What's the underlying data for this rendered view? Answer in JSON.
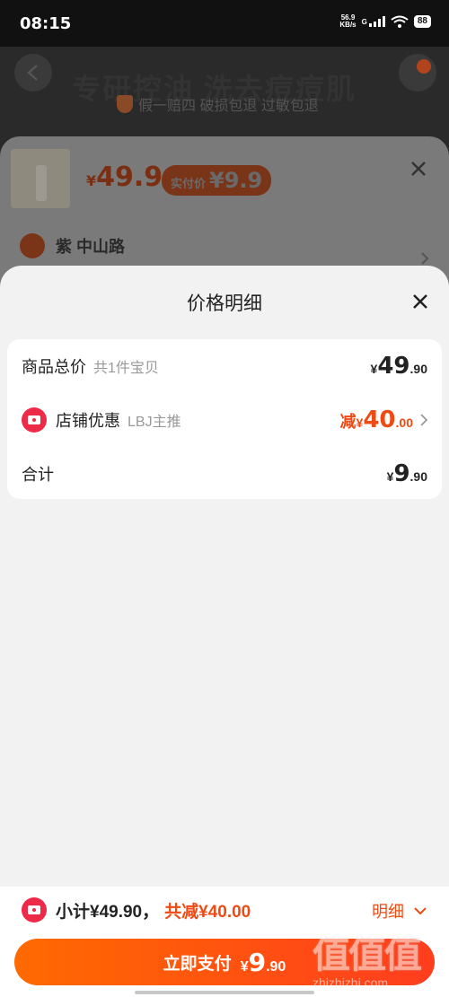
{
  "status_bar": {
    "time": "08:15",
    "net_speed_value": "56.9",
    "net_speed_unit": "KB/s",
    "signal_label": "G",
    "battery": "88"
  },
  "background_page": {
    "banner_text": "专研控油 洗去痘痘肌",
    "guarantee_text": "假一赔四 破损包退 过敏包退"
  },
  "product_sheet": {
    "currency": "¥",
    "price": "49.9",
    "paid_price_label": "实付价",
    "paid_price_value": "¥9.9",
    "address": "紫 中山路"
  },
  "price_detail": {
    "title": "价格明细",
    "rows": [
      {
        "label": "商品总价",
        "sub": "共1件宝贝",
        "prefix": "",
        "currency": "¥",
        "int": "49",
        "dec": ".90"
      },
      {
        "label": "店铺优惠",
        "sub": "LBJ主推",
        "prefix": "减",
        "currency": "¥",
        "int": "40",
        "dec": ".00"
      },
      {
        "label": "合计",
        "sub": "",
        "prefix": "",
        "currency": "¥",
        "int": "9",
        "dec": ".90"
      }
    ]
  },
  "bottom_bar": {
    "subtotal": "小计¥49.90，",
    "discount": "共减¥40.00",
    "detail_toggle": "明细",
    "pay_button": {
      "label": "立即支付",
      "currency": "¥",
      "int": "9",
      "dec": ".90"
    }
  },
  "watermark": {
    "logo": "值值值",
    "site": "zhizhizhi.com"
  },
  "colors": {
    "accent": "#f04a14",
    "store_icon": "#ee2a49",
    "pay_gradient_start": "#ff6a00",
    "pay_gradient_end": "#ff3d1e"
  },
  "icons": [
    "close-icon",
    "store-coupon-icon",
    "chevron-right-icon",
    "chevron-down-icon",
    "back-arrow-icon",
    "location-pin-icon",
    "shield-icon",
    "wifi-icon",
    "signal-icon",
    "battery-icon"
  ]
}
